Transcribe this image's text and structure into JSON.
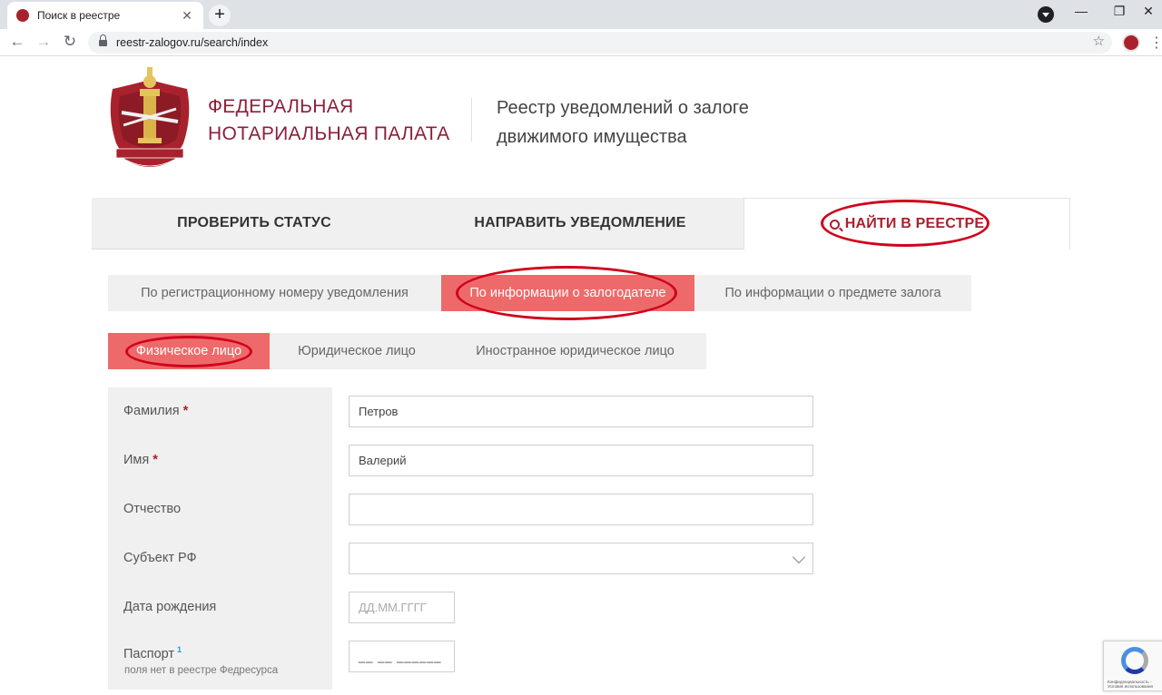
{
  "browser": {
    "tab_title": "Поиск в реестре",
    "tab_close": "✕",
    "new_tab": "+",
    "url": "reestr-zalogov.ru/search/index",
    "back": "←",
    "forward": "→",
    "reload": "↻",
    "star": "☆",
    "minimize": "—",
    "restore": "❐",
    "close": "✕",
    "menu": "⋮"
  },
  "header": {
    "org_line1": "ФЕДЕРАЛЬНАЯ",
    "org_line2": "НОТАРИАЛЬНАЯ ПАЛАТА",
    "registry_line1": "Реестр уведомлений о залоге",
    "registry_line2": "движимого имущества"
  },
  "main_nav": {
    "items": [
      {
        "label": "ПРОВЕРИТЬ СТАТУС"
      },
      {
        "label": "НАПРАВИТЬ УВЕДОМЛЕНИЕ"
      },
      {
        "label": "НАЙТИ В РЕЕСТРЕ"
      }
    ]
  },
  "search_tabs": [
    {
      "label": "По регистрационному номеру уведомления"
    },
    {
      "label": "По информации о залогодателе"
    },
    {
      "label": "По информации о предмете залога"
    }
  ],
  "person_tabs": [
    {
      "label": "Физическое лицо"
    },
    {
      "label": "Юридическое лицо"
    },
    {
      "label": "Иностранное юридическое лицо"
    }
  ],
  "form": {
    "last_name": {
      "label": "Фамилия",
      "required": "*",
      "value": "Петров"
    },
    "first_name": {
      "label": "Имя",
      "required": "*",
      "value": "Валерий"
    },
    "patronymic": {
      "label": "Отчество",
      "value": ""
    },
    "region": {
      "label": "Субъект РФ",
      "value": ""
    },
    "birth_date": {
      "label": "Дата рождения",
      "placeholder": "ДД.ММ.ГГГГ"
    },
    "passport": {
      "label": "Паспорт",
      "footnote": "1",
      "hint": "поля нет в реестре Федресурса",
      "mask": "__ __ ______"
    }
  },
  "recaptcha": {
    "text": "Конфиденциальность - Условия использования"
  },
  "colors": {
    "accent": "#a8222d",
    "active_tab": "#ee6a6a",
    "annotation": "#d0021b"
  }
}
